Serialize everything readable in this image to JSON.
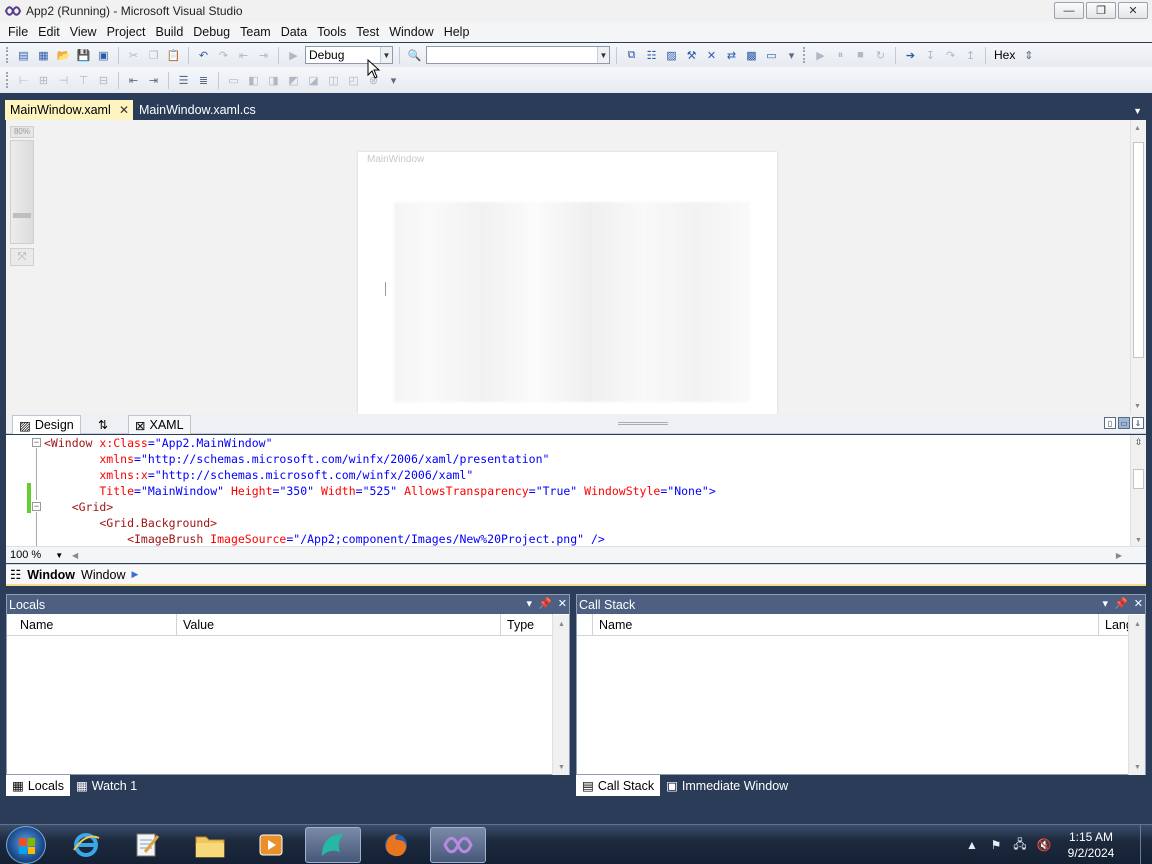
{
  "window": {
    "title": "App2 (Running) - Microsoft Visual Studio",
    "minimize": "—",
    "maximize": "❐",
    "close": "✕"
  },
  "menu": [
    "File",
    "Edit",
    "View",
    "Project",
    "Build",
    "Debug",
    "Team",
    "Data",
    "Tools",
    "Test",
    "Window",
    "Help"
  ],
  "toolbar": {
    "configuration": "Debug",
    "platform": "",
    "hex_label": "Hex"
  },
  "tabs": {
    "doc1": "MainWindow.xaml",
    "doc2": "MainWindow.xaml.cs",
    "close": "✕"
  },
  "design": {
    "zoom_label": "80%",
    "window_title": "MainWindow"
  },
  "view_tabs": {
    "design": "Design",
    "swap": "⇅",
    "xaml": "XAML"
  },
  "code": {
    "lines": [
      {
        "tag": "<Window",
        "attr": " x:Class",
        "eq": "=",
        "val": "\"App2.MainWindow\"",
        "rest": ""
      },
      {
        "tag": "",
        "attr": "        xmlns",
        "eq": "=",
        "val": "\"http://schemas.microsoft.com/winfx/2006/xaml/presentation\"",
        "rest": ""
      },
      {
        "tag": "",
        "attr": "        xmlns:x",
        "eq": "=",
        "val": "\"http://schemas.microsoft.com/winfx/2006/xaml\"",
        "rest": ""
      },
      {
        "tag": "",
        "attr": "        Title",
        "eq": "=",
        "val": "\"MainWindow\"",
        "rest": "title"
      },
      {
        "tag": "    <Grid>",
        "attr": "",
        "eq": "",
        "val": "",
        "rest": ""
      },
      {
        "tag": "        <Grid.Background>",
        "attr": "",
        "eq": "",
        "val": "",
        "rest": ""
      },
      {
        "tag": "            <ImageBrush",
        "attr": " ImageSource",
        "eq": "=",
        "val": "\"/App2;component/Images/New%20Project.png\"",
        "rest": " />"
      }
    ],
    "title_line_tail": [
      {
        "attr": " Height",
        "val": "\"350\""
      },
      {
        "attr": " Width",
        "val": "\"525\""
      },
      {
        "attr": " AllowsTransparency",
        "val": "\"True\""
      },
      {
        "attr": " WindowStyle",
        "val": "\"None\""
      }
    ],
    "close_bracket": ">",
    "zoom": "100 %"
  },
  "breadcrumb": {
    "element": "Window",
    "type": "Window"
  },
  "locals": {
    "title": "Locals",
    "columns": [
      "Name",
      "Value",
      "Type"
    ]
  },
  "callstack": {
    "title": "Call Stack",
    "columns": [
      "Name",
      "Lang"
    ]
  },
  "bottom_tabs_left": [
    "Locals",
    "Watch 1"
  ],
  "bottom_tabs_right": [
    "Call Stack",
    "Immediate Window"
  ],
  "taskbar": {
    "time": "1:15 AM",
    "date": "9/2/2024"
  },
  "colors": {
    "ide_background": "#2b3c59",
    "active_tab": "#fdf4bf",
    "toolwindow_header": "#4d6082",
    "xaml_tag": "#a31515",
    "xaml_attribute": "#ff0000",
    "xaml_value": "#0000ff"
  }
}
